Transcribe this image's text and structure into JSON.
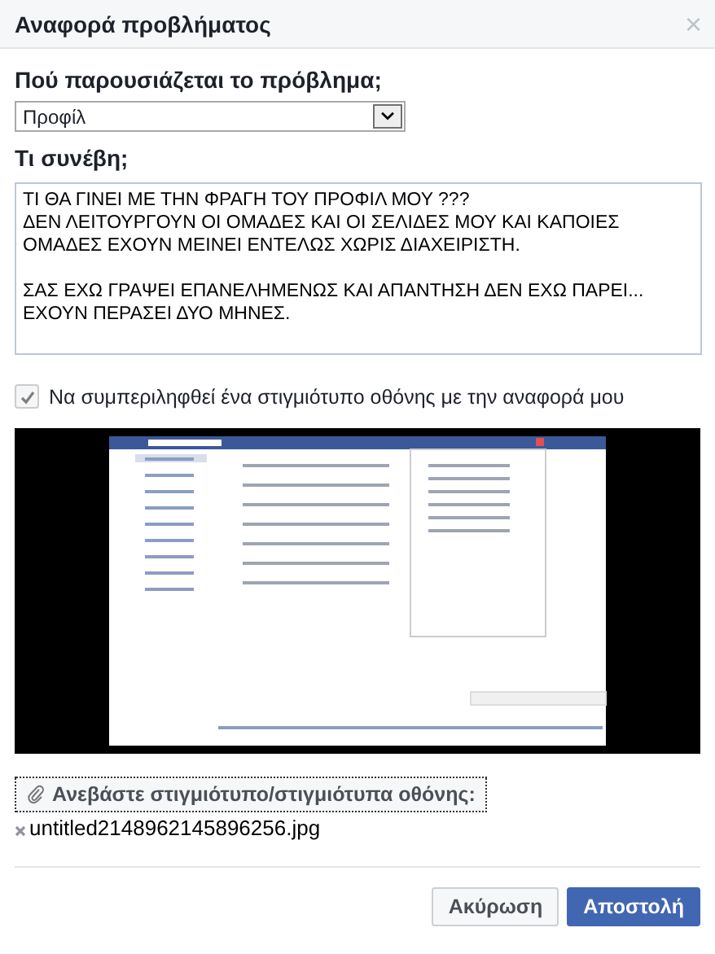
{
  "dialog": {
    "title": "Αναφορά προβλήματος",
    "close": "×"
  },
  "location": {
    "label": "Πού παρουσιάζεται το πρόβλημα;",
    "value": "Προφίλ"
  },
  "description": {
    "label": "Τι συνέβη;",
    "value": "ΤΙ ΘΑ ΓΙΝΕΙ ΜΕ ΤΗΝ ΦΡΑΓΗ ΤΟΥ ΠΡΟΦΙΛ ΜΟΥ ???\nΔΕΝ ΛΕΙΤΟΥΡΓΟΥΝ ΟΙ ΟΜΑΔΕΣ ΚΑΙ ΟΙ ΣΕΛΙΔΕΣ ΜΟΥ ΚΑΙ ΚΑΠΟΙΕΣ ΟΜΑΔΕΣ ΕΧΟΥΝ ΜΕΙΝΕΙ ΕΝΤΕΛΩΣ ΧΩΡΙΣ ΔΙΑΧΕΙΡΙΣΤΗ.\n\nΣΑΣ ΕΧΩ ΓΡΑΨΕΙ ΕΠΑΝΕΛΗΜΕΝΩΣ ΚΑΙ ΑΠΑΝΤΗΣΗ ΔΕΝ ΕΧΩ ΠΑΡΕΙ...\nΕΧΟΥΝ ΠΕΡΑΣΕΙ ΔΥΟ ΜΗΝΕΣ."
  },
  "include_screenshot": {
    "label": "Να συμπεριληφθεί ένα στιγμιότυπο οθόνης με την αναφορά μου",
    "checked": true
  },
  "upload": {
    "label": "Ανεβάστε στιγμιότυπο/στιγμιότυπα οθόνης:",
    "files": [
      "untitled2148962145896256.jpg"
    ]
  },
  "buttons": [
    {
      "label": "Ακύρωση",
      "kind": "secondary"
    },
    {
      "label": "Αποστολή",
      "kind": "primary"
    }
  ]
}
